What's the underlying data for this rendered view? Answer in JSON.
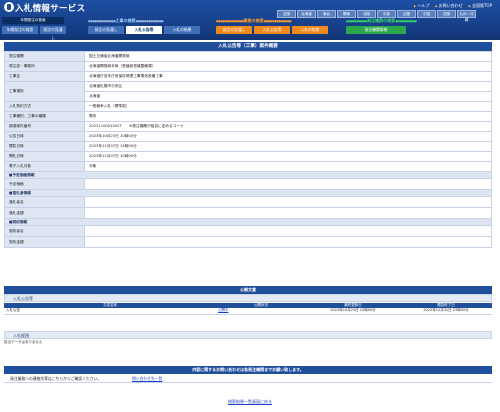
{
  "header": {
    "app_title": "入札情報サービス",
    "top_links": [
      "ヘルプ",
      "お問い合わせ",
      "全国版TOP"
    ],
    "regions": [
      "全国",
      "北海道",
      "東北",
      "関東",
      "北陸",
      "中部",
      "近畿",
      "中国",
      "四国",
      "九州・沖縄"
    ],
    "groups": [
      {
        "title": "工事の検索"
      },
      {
        "title": "業務の検索"
      },
      {
        "title": "発注機関の検索"
      }
    ],
    "kz_label": "年間発注の検索",
    "tabs_b1": [
      "年間発注の検索",
      "発注の見通し"
    ],
    "tabs_b2": [
      "発注の見通し",
      "入札公告等",
      "入札の結果"
    ],
    "tabs_b3": [
      "発注の見通し",
      "入札公告等",
      "入札の結果"
    ],
    "tabs_b4": [
      "発注機関情報"
    ]
  },
  "page": {
    "title": "入札公告等（工事）案件概要"
  },
  "fields": [
    {
      "label": "発注機関",
      "value": "国土交通省北海道開発局"
    },
    {
      "label": "発注部・事務所",
      "value": "北海道開発局本局（営繕部営繕整備課）"
    },
    {
      "label": "工事名",
      "value": "北海道庁旧本庁舎保存修理工事電気設備工事"
    },
    {
      "label": "工事場所",
      "value": "北海道札幌市中央区",
      "value2": "北海道"
    },
    {
      "label": "入札契約方式",
      "value": "一般競争入札（標準型）"
    },
    {
      "label": "工事種別／工事の種類",
      "value": "電気"
    },
    {
      "label": "調達案件番号",
      "value": "2023110051002T　　※発注機関が独自に定めるコード"
    },
    {
      "label": "公告日時",
      "value": "2023年10月23日 10時00分"
    },
    {
      "label": "閲覧日時",
      "value": "2023年11月07日 14時00分"
    },
    {
      "label": "開札日時",
      "value": "2023年11月07日 10時00分"
    },
    {
      "label": "電子入札対象",
      "value": "対象"
    }
  ],
  "section_schedule": "予定価格情報",
  "schedule_fields": [
    {
      "label": "予定価格",
      "value": ""
    }
  ],
  "section_winner": "落札者情報",
  "winner_fields": [
    {
      "label": "落札者名",
      "value": ""
    },
    {
      "label": "落札金額",
      "value": ""
    }
  ],
  "section_contract": "契約情報",
  "contract_fields": [
    {
      "label": "契約者名",
      "value": ""
    },
    {
      "label": "契約金額",
      "value": ""
    }
  ],
  "announce": {
    "title": "公開文書",
    "sub_title": "入札公告等",
    "columns": [
      "文書名称",
      "公開状況",
      "最終更新日",
      "閲覧終了日"
    ],
    "rows": [
      {
        "name": "入札公告",
        "status": "公開中",
        "updated": "2023年10月23日 10時00分",
        "end": "2023年12月31日 23時00分"
      }
    ],
    "result_title": "入札経過",
    "result_text": "該当データはありません"
  },
  "inquiry": {
    "bar": "内容に関するお問い合わせは各発注機関までお願い致します。",
    "left": "発注業務への連絡先等はこちらからご確認ください。",
    "right": "問い合わせ先一覧"
  },
  "back_link": "検索結果一覧画面に戻る",
  "colors": {
    "brand_blue": "#1f4e9b",
    "orange": "#f08a1c",
    "green": "#2aa84b"
  }
}
